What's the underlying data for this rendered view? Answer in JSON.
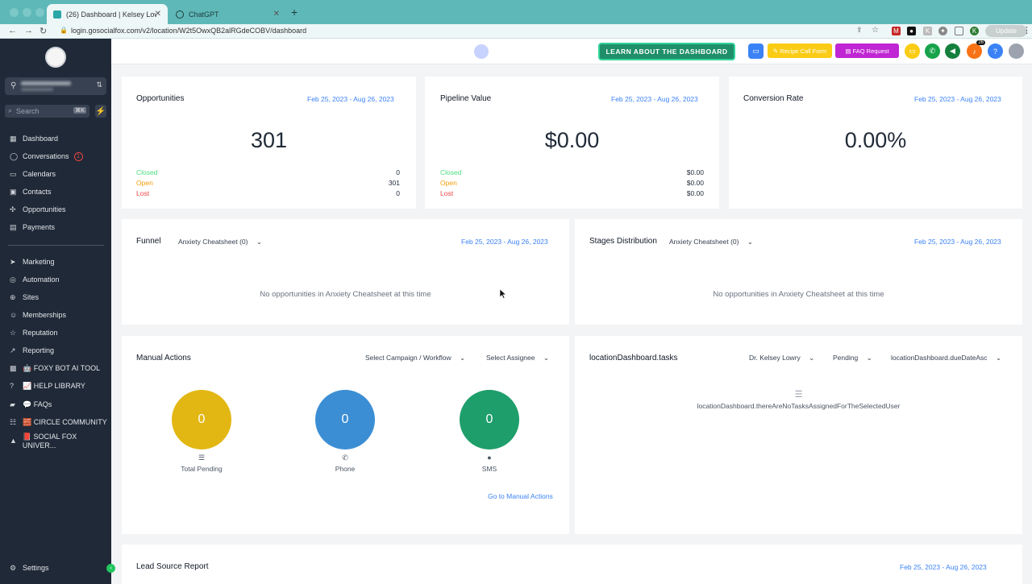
{
  "browser": {
    "tabs": [
      {
        "label": "(26) Dashboard | Kelsey Lowry",
        "active": true
      },
      {
        "label": "ChatGPT",
        "active": false
      }
    ],
    "url": "login.gosocialfox.com/v2/location/W2t5OwxQB2alRGdeCOBV/dashboard",
    "update_label": "Update"
  },
  "sidebar": {
    "search_placeholder": "Search",
    "search_shortcut": "⌘K",
    "items_top": [
      {
        "label": "Dashboard",
        "icon": "grid-icon"
      },
      {
        "label": "Conversations",
        "icon": "chat-icon",
        "badge": "1"
      },
      {
        "label": "Calendars",
        "icon": "calendar-icon"
      },
      {
        "label": "Contacts",
        "icon": "contacts-icon"
      },
      {
        "label": "Opportunities",
        "icon": "opportunities-icon"
      },
      {
        "label": "Payments",
        "icon": "payments-icon"
      }
    ],
    "items_bottom": [
      {
        "label": "Marketing",
        "icon": "send-icon"
      },
      {
        "label": "Automation",
        "icon": "automation-icon"
      },
      {
        "label": "Sites",
        "icon": "globe-icon"
      },
      {
        "label": "Memberships",
        "icon": "members-icon"
      },
      {
        "label": "Reputation",
        "icon": "star-icon"
      },
      {
        "label": "Reporting",
        "icon": "chart-line-icon"
      },
      {
        "label": "🤖 FOXY BOT AI TOOL",
        "icon": "robot-icon"
      },
      {
        "label": "📈 HELP LIBRARY",
        "icon": "help-icon"
      },
      {
        "label": "💬 FAQs",
        "icon": "chat-bubble-icon"
      },
      {
        "label": "🧱 CIRCLE COMMUNITY",
        "icon": "community-icon"
      },
      {
        "label": "📕 SOCIAL FOX UNIVER...",
        "icon": "graduation-icon"
      }
    ],
    "settings_label": "Settings"
  },
  "header": {
    "learn_button": "LEARN ABOUT THE DASHBOARD",
    "recipe_button": "✎ Recipe Call Form",
    "faq_button": "▤ FAQ Request",
    "notification_count": "26"
  },
  "opportunities": {
    "title": "Opportunities",
    "date": "Feb 25, 2023 - Aug 26, 2023",
    "value": "301",
    "rows": [
      {
        "label": "Closed",
        "value": "0"
      },
      {
        "label": "Open",
        "value": "301"
      },
      {
        "label": "Lost",
        "value": "0"
      }
    ]
  },
  "pipeline": {
    "title": "Pipeline Value",
    "date": "Feb 25, 2023 - Aug 26, 2023",
    "value": "$0.00",
    "rows": [
      {
        "label": "Closed",
        "value": "$0.00"
      },
      {
        "label": "Open",
        "value": "$0.00"
      },
      {
        "label": "Lost",
        "value": "$0.00"
      }
    ]
  },
  "conversion": {
    "title": "Conversion Rate",
    "date": "Feb 25, 2023 - Aug 26, 2023",
    "value": "0.00%"
  },
  "funnel": {
    "title": "Funnel",
    "pipeline_select": "Anxiety Cheatsheet (0)",
    "date": "Feb 25, 2023 - Aug 26, 2023",
    "empty": "No opportunities in Anxiety Cheatsheet at this time"
  },
  "stages": {
    "title": "Stages Distribution",
    "pipeline_select": "Anxiety Cheatsheet (0)",
    "date": "Feb 25, 2023 - Aug 26, 2023",
    "empty": "No opportunities in Anxiety Cheatsheet at this time"
  },
  "manual_actions": {
    "title": "Manual Actions",
    "campaign_select": "Select Campaign / Workflow",
    "assignee_select": "Select Assignee",
    "items": [
      {
        "value": "0",
        "label": "Total Pending",
        "color": "#e2b714"
      },
      {
        "value": "0",
        "label": "Phone",
        "color": "#3b8ed4"
      },
      {
        "value": "0",
        "label": "SMS",
        "color": "#1e9e6a"
      }
    ],
    "link": "Go to Manual Actions"
  },
  "tasks": {
    "title": "locationDashboard.tasks",
    "user_select": "Dr. Kelsey Lowry",
    "status_select": "Pending",
    "sort_select": "locationDashboard.dueDateAsc",
    "empty": "locationDashboard.thereAreNoTasksAssignedForTheSelectedUser"
  },
  "lead_source": {
    "title": "Lead Source Report",
    "date": "Feb 25, 2023 - Aug 26, 2023"
  },
  "colors": {
    "closed": "#4ade80",
    "open": "#f59e0b",
    "lost": "#ef4444",
    "link": "#3b82f6",
    "sidebar": "#1f2937"
  }
}
